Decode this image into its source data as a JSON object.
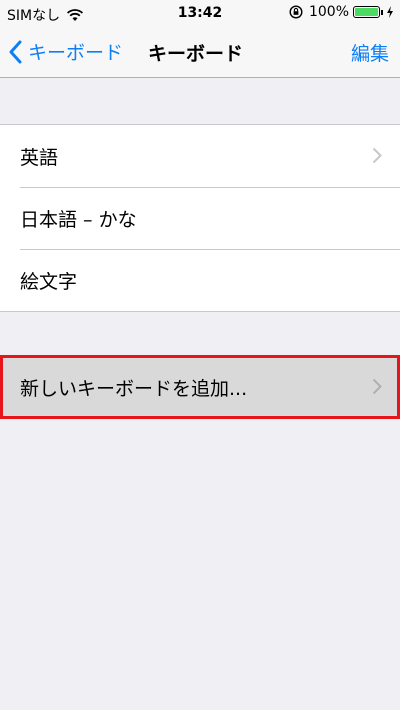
{
  "status_bar": {
    "carrier": "SIMなし",
    "time": "13:42",
    "battery_percent": "100%"
  },
  "nav": {
    "back_label": "キーボード",
    "title": "キーボード",
    "edit_label": "編集"
  },
  "keyboards": [
    {
      "label": "英語",
      "has_chevron": true
    },
    {
      "label": "日本語 – かな",
      "has_chevron": false
    },
    {
      "label": "絵文字",
      "has_chevron": false
    }
  ],
  "add_keyboard": {
    "label": "新しいキーボードを追加...",
    "highlighted": true
  },
  "colors": {
    "accent": "#0d7ff5",
    "highlight_border": "#e8141c",
    "background": "#efeff4",
    "battery": "#4cd964"
  },
  "icons": [
    "wifi-icon",
    "orientation-lock-icon",
    "battery-icon",
    "charging-bolt-icon",
    "back-chevron-icon",
    "disclosure-chevron-icon"
  ]
}
